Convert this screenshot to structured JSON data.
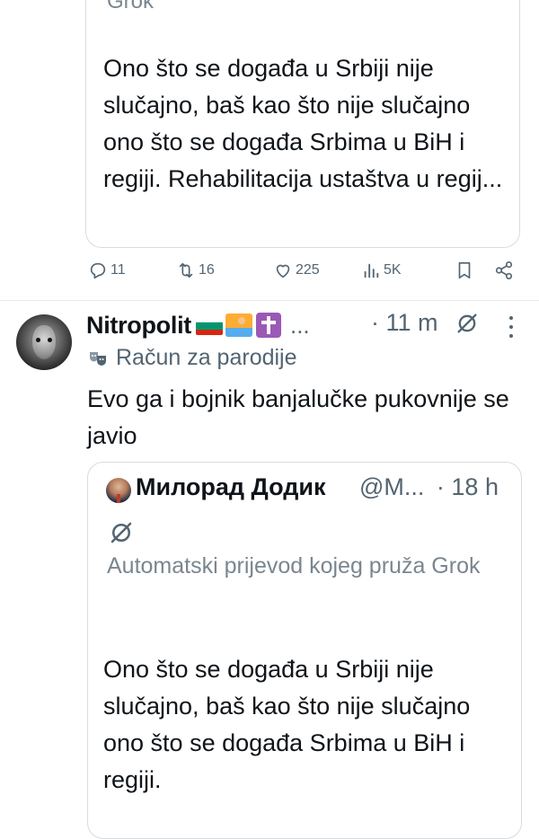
{
  "quoted_top": {
    "translation_tail": "Grok",
    "text": "Ono što se događa u Srbiji nije slučajno, baš kao što nije slučajno ono što se događa Srbima u BiH i regiji. Rehabilitacija ustaštva u regij..."
  },
  "actions": {
    "replies": "11",
    "reposts": "16",
    "likes": "225",
    "views": "5K"
  },
  "tweet": {
    "display_name": "Nitropolit",
    "name_emojis": [
      "bulgaria-flag-icon",
      "swimmer-icon",
      "latin-cross-icon"
    ],
    "name_ellipsis": "...",
    "time": "· 11 m",
    "parody_label": "Račun za parodije",
    "text": "Evo ga i bojnik banjalučke pukovnije se javio"
  },
  "quoted": {
    "display_name": "Милорад Додик",
    "handle": "@M...",
    "time": "· 18 h",
    "translation_note": "Automatski prijevod kojeg pruža Grok",
    "text": "Ono što se događa u Srbiji nije slučajno, baš kao što nije slučajno ono što se događa Srbima u BiH i regiji."
  },
  "colors": {
    "text": "#0f1419",
    "muted": "#536471",
    "border": "#d6dce0"
  }
}
